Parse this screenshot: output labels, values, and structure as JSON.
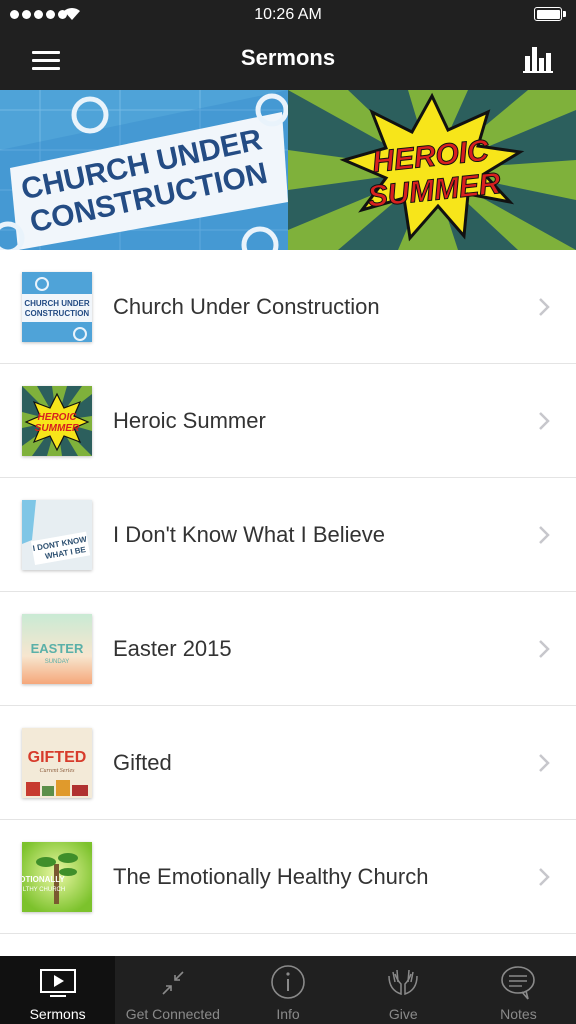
{
  "status_bar": {
    "time": "10:26 AM"
  },
  "nav": {
    "title": "Sermons"
  },
  "banner": [
    {
      "name": "Church Under Construction",
      "line1": "CHURCH UNDER",
      "line2": "CONSTRUCTION"
    },
    {
      "name": "Heroic Summer",
      "line1": "HEROIC",
      "line2": "SUMMER"
    }
  ],
  "sermons": [
    {
      "title": "Church Under Construction",
      "thumb_line1": "CHURCH UNDER",
      "thumb_line2": "CONSTRUCTION"
    },
    {
      "title": "Heroic Summer",
      "thumb_line1": "HEROIC",
      "thumb_line2": "SUMMER"
    },
    {
      "title": "I Don't Know What I Believe",
      "thumb_line1": "I DONT KNOW",
      "thumb_line2": "WHAT I BE"
    },
    {
      "title": "Easter 2015",
      "thumb_line1": "EASTER",
      "thumb_line2": "SUNDAY"
    },
    {
      "title": "Gifted",
      "thumb_line1": "GIFTED",
      "thumb_line2": "Current Series"
    },
    {
      "title": "The Emotionally Healthy Church",
      "thumb_line1": "OTIONALLY",
      "thumb_line2": "LTHY CHURCH"
    }
  ],
  "tabs": [
    {
      "label": "Sermons",
      "icon": "play-screen-icon",
      "active": true
    },
    {
      "label": "Get Connected",
      "icon": "arrows-in-icon",
      "active": false
    },
    {
      "label": "Info",
      "icon": "info-icon",
      "active": false
    },
    {
      "label": "Give",
      "icon": "hands-icon",
      "active": false
    },
    {
      "label": "Notes",
      "icon": "speech-bubble-icon",
      "active": false
    }
  ],
  "colors": {
    "bar_background": "#202020",
    "active_tab": "#111111",
    "inactive_tab_text": "#8a8a8a",
    "row_text": "#333333",
    "divider": "#e4e4e4",
    "chevron": "#c7c7cc"
  }
}
